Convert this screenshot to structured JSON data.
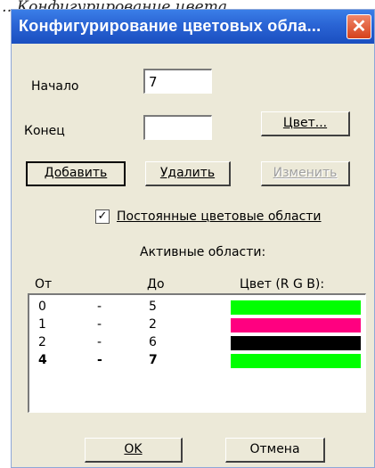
{
  "caption": "…Конфигурирование цвета…",
  "window": {
    "title": "Конфигурирование цветовых обла...",
    "close_glyph": "✕"
  },
  "form": {
    "start_label": "Начало",
    "start_value": "7",
    "end_label": "Конец",
    "end_value": ""
  },
  "buttons": {
    "color": "Цвет...",
    "add": "Добавить",
    "delete": "Удалить",
    "change": "Изменить",
    "ok": "OK",
    "cancel": "Отмена"
  },
  "permanent": {
    "checked": true,
    "check_glyph": "✓",
    "label": "Постоянные цветовые области"
  },
  "active_label": "Активные области:",
  "table": {
    "headers": [
      "От",
      "До",
      "Цвет (R G B):"
    ],
    "rows": [
      {
        "from": "0",
        "dash": "-",
        "to": "5",
        "color": "#00ff00",
        "bold": false
      },
      {
        "from": "1",
        "dash": "-",
        "to": "2",
        "color": "#ff0080",
        "bold": false
      },
      {
        "from": "2",
        "dash": "-",
        "to": "6",
        "color": "#000000",
        "bold": false
      },
      {
        "from": "4",
        "dash": "-",
        "to": "7",
        "color": "#00ff00",
        "bold": true
      }
    ]
  },
  "colors": {
    "titlebar": "#2a64d4",
    "close": "#d6421b",
    "dialog_bg": "#ece9d8"
  }
}
